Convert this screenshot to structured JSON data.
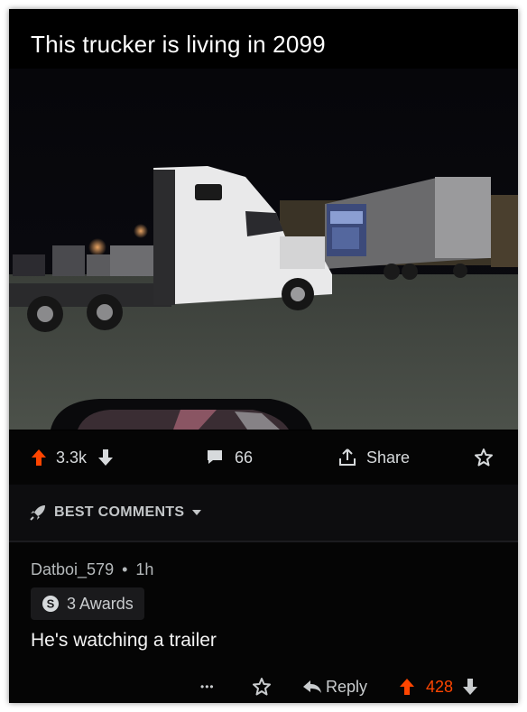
{
  "post": {
    "title": "This trucker is living in 2099"
  },
  "actions": {
    "upvote_count": "3.3k",
    "comment_count": "66",
    "share_label": "Share"
  },
  "sort": {
    "label": "BEST COMMENTS"
  },
  "comment": {
    "author": "Datboi_579",
    "separator": "•",
    "age": "1h",
    "awards": "3 Awards",
    "text": "He's watching a trailer",
    "more": "•••",
    "reply_label": "Reply",
    "score": "428"
  },
  "colors": {
    "upvote": "#ff4500",
    "text_muted": "#b5b9bb",
    "background": "#000000"
  }
}
